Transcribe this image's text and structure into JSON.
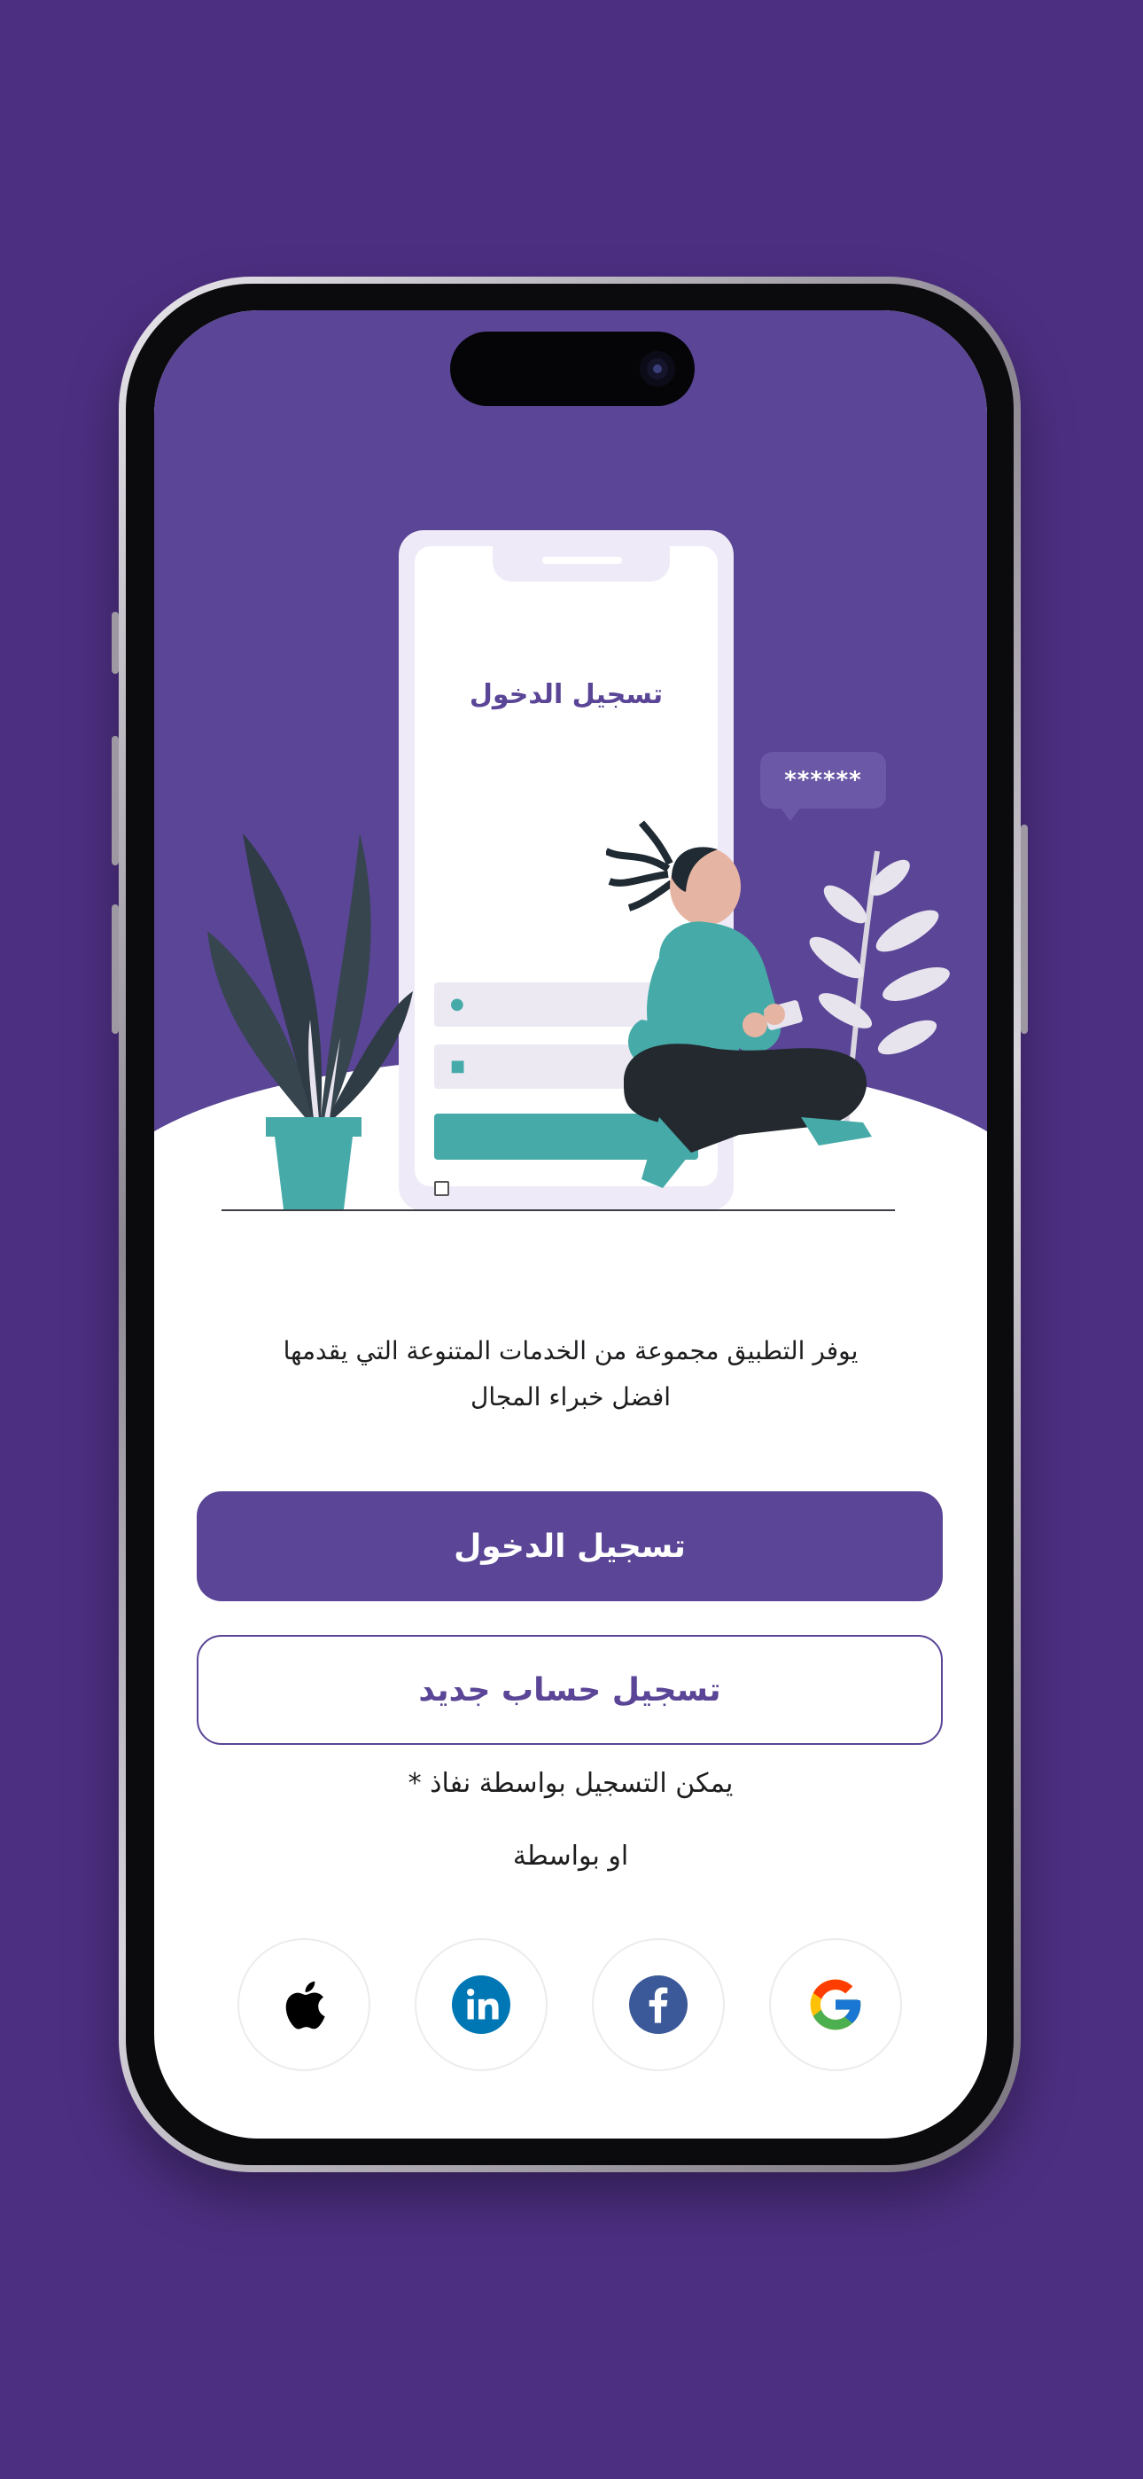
{
  "illustration": {
    "mock_title": "تسجيل الدخول",
    "password_bubble": "******"
  },
  "intro": {
    "line1": "يوفر التطبيق مجموعة من الخدمات المتنوعة التي يقدمها",
    "line2": "افضل خبراء المجال"
  },
  "actions": {
    "login_label": "تسجيل الدخول",
    "register_label": "تسجيل حساب جديد"
  },
  "nafath_note": "يمكن التسجيل بواسطة نفاذ *",
  "or_label": "او بواسطة",
  "social": [
    {
      "name": "google-icon"
    },
    {
      "name": "facebook-icon"
    },
    {
      "name": "linkedin-icon"
    },
    {
      "name": "apple-icon"
    }
  ],
  "colors": {
    "background": "#4d2f82",
    "brand_purple": "#5a4596",
    "accent_teal": "#46aaa8",
    "facebook": "#3b5998",
    "linkedin": "#0077b5"
  }
}
